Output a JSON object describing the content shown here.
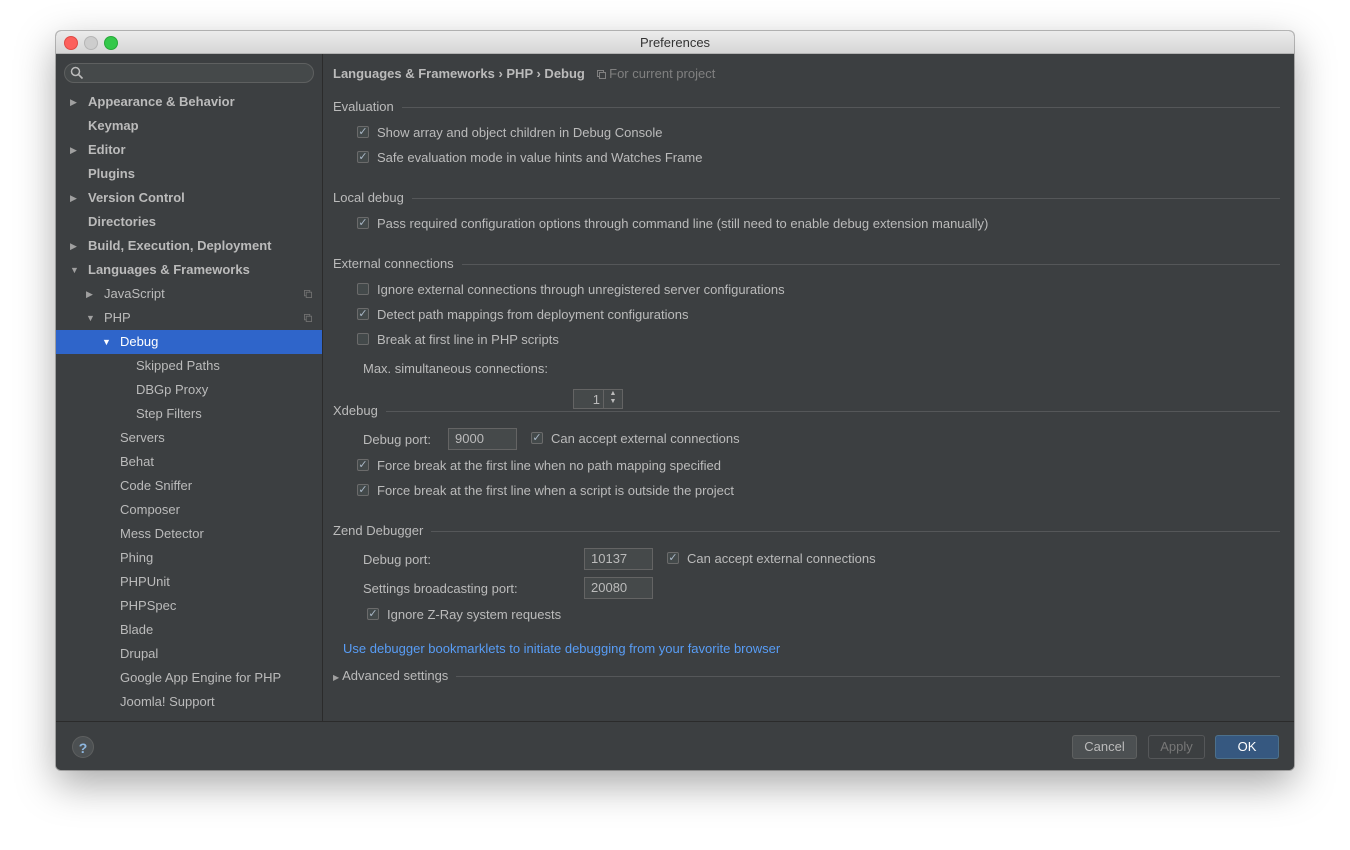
{
  "window": {
    "title": "Preferences"
  },
  "search": {
    "placeholder": ""
  },
  "sidebar": {
    "items": [
      {
        "label": "Appearance & Behavior",
        "level": 0,
        "bold": true,
        "arrow": "right"
      },
      {
        "label": "Keymap",
        "level": 0,
        "bold": true,
        "arrow": ""
      },
      {
        "label": "Editor",
        "level": 0,
        "bold": true,
        "arrow": "right"
      },
      {
        "label": "Plugins",
        "level": 0,
        "bold": true,
        "arrow": ""
      },
      {
        "label": "Version Control",
        "level": 0,
        "bold": true,
        "arrow": "right"
      },
      {
        "label": "Directories",
        "level": 0,
        "bold": true,
        "arrow": ""
      },
      {
        "label": "Build, Execution, Deployment",
        "level": 0,
        "bold": true,
        "arrow": "right"
      },
      {
        "label": "Languages & Frameworks",
        "level": 0,
        "bold": true,
        "arrow": "down"
      },
      {
        "label": "JavaScript",
        "level": 1,
        "bold": false,
        "arrow": "right",
        "copy": true
      },
      {
        "label": "PHP",
        "level": 1,
        "bold": false,
        "arrow": "down",
        "copy": true
      },
      {
        "label": "Debug",
        "level": 2,
        "bold": false,
        "arrow": "down",
        "selected": true
      },
      {
        "label": "Skipped Paths",
        "level": 3,
        "bold": false,
        "arrow": ""
      },
      {
        "label": "DBGp Proxy",
        "level": 3,
        "bold": false,
        "arrow": ""
      },
      {
        "label": "Step Filters",
        "level": 3,
        "bold": false,
        "arrow": ""
      },
      {
        "label": "Servers",
        "level": 2,
        "bold": false,
        "arrow": ""
      },
      {
        "label": "Behat",
        "level": 2,
        "bold": false,
        "arrow": ""
      },
      {
        "label": "Code Sniffer",
        "level": 2,
        "bold": false,
        "arrow": ""
      },
      {
        "label": "Composer",
        "level": 2,
        "bold": false,
        "arrow": ""
      },
      {
        "label": "Mess Detector",
        "level": 2,
        "bold": false,
        "arrow": ""
      },
      {
        "label": "Phing",
        "level": 2,
        "bold": false,
        "arrow": ""
      },
      {
        "label": "PHPUnit",
        "level": 2,
        "bold": false,
        "arrow": ""
      },
      {
        "label": "PHPSpec",
        "level": 2,
        "bold": false,
        "arrow": ""
      },
      {
        "label": "Blade",
        "level": 2,
        "bold": false,
        "arrow": ""
      },
      {
        "label": "Drupal",
        "level": 2,
        "bold": false,
        "arrow": ""
      },
      {
        "label": "Google App Engine for PHP",
        "level": 2,
        "bold": false,
        "arrow": ""
      },
      {
        "label": "Joomla! Support",
        "level": 2,
        "bold": false,
        "arrow": ""
      }
    ]
  },
  "breadcrumb": {
    "path": "Languages & Frameworks  ›  PHP  ›  Debug",
    "scope": "For current project"
  },
  "evaluation": {
    "title": "Evaluation",
    "show_array": {
      "label": "Show array and object children in Debug Console",
      "checked": true
    },
    "safe_eval": {
      "label": "Safe evaluation mode in value hints and Watches Frame",
      "checked": true
    }
  },
  "local_debug": {
    "title": "Local debug",
    "pass_config": {
      "label": "Pass required configuration options through command line (still need to enable debug extension manually)",
      "checked": true
    }
  },
  "external": {
    "title": "External connections",
    "ignore_unreg": {
      "label": "Ignore external connections through unregistered server configurations",
      "checked": false
    },
    "detect_paths": {
      "label": "Detect path mappings from deployment configurations",
      "checked": true
    },
    "break_first": {
      "label": "Break at first line in PHP scripts",
      "checked": false
    },
    "max_conn_label": "Max. simultaneous connections:",
    "max_conn_value": "1"
  },
  "xdebug": {
    "title": "Xdebug",
    "port_label": "Debug port:",
    "port_value": "9000",
    "accept_ext": {
      "label": "Can accept external connections",
      "checked": true
    },
    "force_break_nomap": {
      "label": "Force break at the first line when no path mapping specified",
      "checked": true
    },
    "force_break_outside": {
      "label": "Force break at the first line when a script is outside the project",
      "checked": true
    }
  },
  "zend": {
    "title": "Zend Debugger",
    "port_label": "Debug port:",
    "port_value": "10137",
    "accept_ext": {
      "label": "Can accept external connections",
      "checked": true
    },
    "bcast_label": "Settings broadcasting port:",
    "bcast_value": "20080",
    "ignore_zray": {
      "label": "Ignore Z-Ray system requests",
      "checked": true
    }
  },
  "bookmarklets_link": "Use debugger bookmarklets to initiate debugging from your favorite browser",
  "advanced": {
    "label": "Advanced settings"
  },
  "footer": {
    "help": "?",
    "cancel": "Cancel",
    "apply": "Apply",
    "ok": "OK"
  },
  "colors": {
    "selection": "#2f65ca",
    "link": "#589df6",
    "ok_button": "#365880",
    "background": "#3c3f41"
  }
}
